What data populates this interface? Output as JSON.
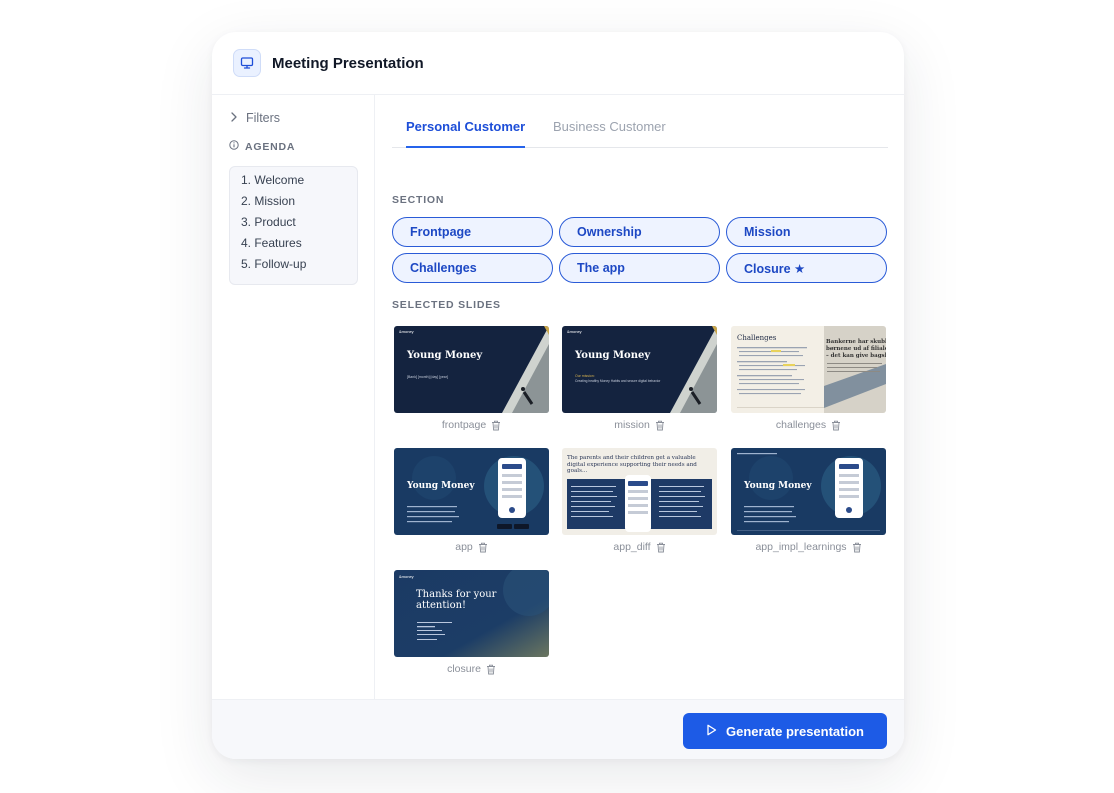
{
  "window": {
    "title": "Meeting Presentation"
  },
  "sidebar": {
    "filters_label": "Filters",
    "agenda_label": "AGENDA",
    "agenda_items": [
      "1. Welcome",
      "2. Mission",
      "3. Product",
      "4. Features",
      "5. Follow-up"
    ]
  },
  "tabs": [
    {
      "label": "Personal Customer",
      "active": true
    },
    {
      "label": "Business Customer",
      "active": false
    }
  ],
  "section": {
    "label": "SECTION",
    "chips": [
      "Frontpage",
      "Ownership",
      "Mission",
      "Challenges",
      "The app",
      "Closure ★"
    ]
  },
  "selected_slides": {
    "label": "SELECTED SLIDES",
    "items": [
      {
        "name": "frontpage",
        "logo": "&money",
        "heading": "Young Money",
        "subtext": "[Bank] [month] [day] [year]"
      },
      {
        "name": "mission",
        "logo": "&money",
        "heading": "Young Money",
        "subtext_accent": "Our mission:",
        "subtext": "Creating healthy Money Habits and secure digital behavior"
      },
      {
        "name": "challenges",
        "heading": "Challenges",
        "newspaper": "Bankerne har skubbet børnene ud af filialen – det kan give bagslag"
      },
      {
        "name": "app",
        "heading": "Young Money"
      },
      {
        "name": "app_diff",
        "heading": "The parents and their children get a valuable digital experience supporting their needs and goals..."
      },
      {
        "name": "app_impl_learnings",
        "heading": "Young Money"
      },
      {
        "name": "closure",
        "logo": "&money",
        "heading": "Thanks for your attention!"
      }
    ]
  },
  "footer": {
    "generate_label": "Generate presentation"
  },
  "colors": {
    "accent": "#1d5be6",
    "chip_border": "#2a5bd7",
    "chip_bg": "#eef3ff",
    "slide_navy": "#14233f"
  },
  "icons": {
    "app": "monitor-icon",
    "filters": "chevron-right-icon",
    "agenda": "info-circle-icon",
    "delete": "trash-icon",
    "generate": "play-icon"
  }
}
